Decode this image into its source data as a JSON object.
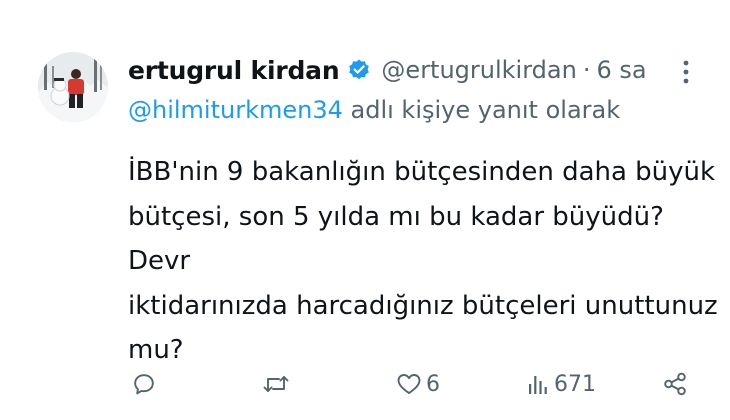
{
  "tweet": {
    "display_name": "ertugrul kirdan",
    "handle": "@ertugrulkirdan",
    "separator": "·",
    "time": "6 sa",
    "reply_to": {
      "mention": "@hilmiturkmen34",
      "suffix": "adlı kişiye yanıt olarak"
    },
    "text_lines": [
      "İBB'nin 9 bakanlığın bütçesinden daha büyük",
      "bütçesi, son 5 yılda mı bu kadar büyüdü? Devr",
      "iktidarınızda harcadığınız bütçeleri unuttunuz",
      "mu?"
    ],
    "stats": {
      "likes": "6",
      "views": "671"
    }
  },
  "icons": {
    "verified": "verified-badge-icon",
    "more": "more-options-icon",
    "reply": "reply-icon",
    "retweet": "retweet-icon",
    "like": "heart-icon",
    "views": "views-chart-icon",
    "share": "share-icon"
  },
  "colors": {
    "accent": "#1d9bf0",
    "muted": "#536471",
    "text": "#0f1419",
    "background": "#ffffff"
  }
}
